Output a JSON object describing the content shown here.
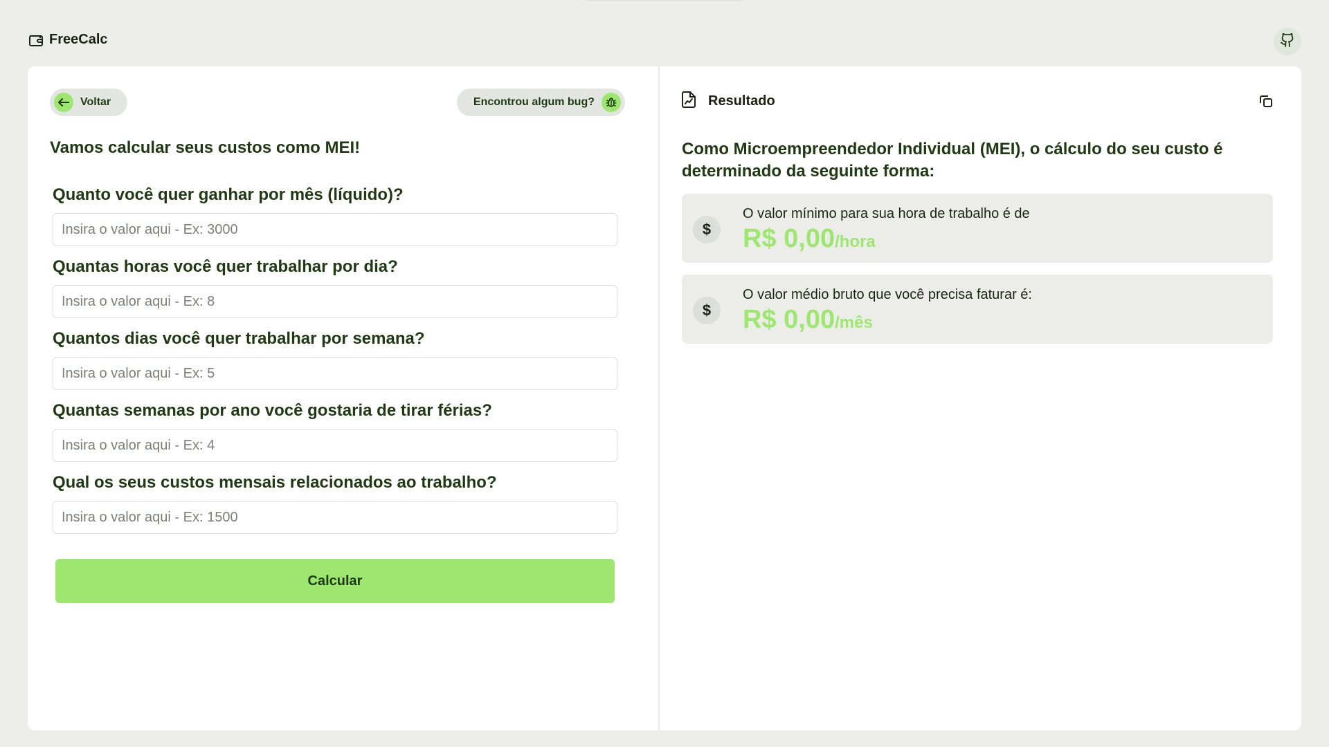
{
  "app": {
    "name": "FreeCalc"
  },
  "header": {
    "github_icon": "github-icon",
    "wallet_icon": "wallet-icon"
  },
  "nav": {
    "back_label": "Voltar",
    "bug_label": "Encontrou algum bug?"
  },
  "form": {
    "title": "Vamos calcular seus custos como MEI!",
    "fields": [
      {
        "question": "Quanto você quer ganhar por mês (líquido)?",
        "placeholder": "Insira o valor aqui - Ex: 3000",
        "value": ""
      },
      {
        "question": "Quantas horas você quer trabalhar por dia?",
        "placeholder": "Insira o valor aqui - Ex: 8",
        "value": ""
      },
      {
        "question": "Quantos dias você quer trabalhar por semana?",
        "placeholder": "Insira o valor aqui - Ex: 5",
        "value": ""
      },
      {
        "question": "Quantas semanas por ano você gostaria de tirar férias?",
        "placeholder": "Insira o valor aqui - Ex: 4",
        "value": ""
      },
      {
        "question": "Qual os seus custos mensais relacionados ao trabalho?",
        "placeholder": "Insira o valor aqui - Ex: 1500",
        "value": ""
      }
    ],
    "submit_label": "Calcular"
  },
  "result": {
    "title": "Resultado",
    "intro": "Como Microempreendedor Individual (MEI), o cálculo do seu custo é determinado da seguinte forma:",
    "cards": [
      {
        "icon_text": "$",
        "description": "O valor mínimo para sua hora de trabalho é de",
        "value": "R$ 0,00",
        "unit": "/hora"
      },
      {
        "icon_text": "$",
        "description": "O valor médio bruto que você precisa faturar é:",
        "value": "R$ 0,00",
        "unit": "/mês"
      }
    ]
  },
  "colors": {
    "accent": "#9de66f",
    "background": "#ecede9",
    "text": "#1f3a12",
    "card": "#ffffff"
  }
}
